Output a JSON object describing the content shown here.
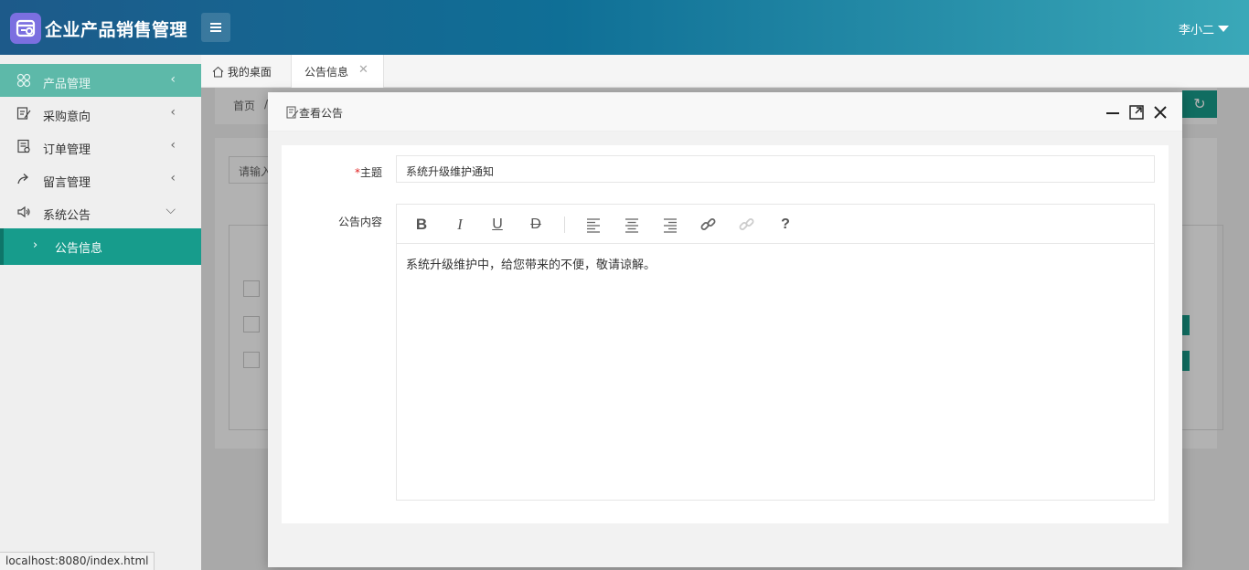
{
  "app": {
    "title": "企业产品销售管理",
    "user": "李小二"
  },
  "sidebar": {
    "items": [
      {
        "label": "产品管理",
        "icon": "grid-icon"
      },
      {
        "label": "采购意向",
        "icon": "edit-icon"
      },
      {
        "label": "订单管理",
        "icon": "order-icon"
      },
      {
        "label": "留言管理",
        "icon": "share-icon"
      },
      {
        "label": "系统公告",
        "icon": "speaker-icon"
      }
    ],
    "sub_item": {
      "label": "公告信息"
    }
  },
  "tabs": {
    "home": "我的桌面",
    "current": "公告信息"
  },
  "background": {
    "breadcrumb_home": "首页",
    "breadcrumb_sep": "/",
    "search_placeholder": "请输入"
  },
  "modal": {
    "title": "查看公告",
    "subject_label": "主题",
    "subject_value": "系统升级维护通知",
    "content_label": "公告内容",
    "content_text": "系统升级维护中，给您带来的不便，敬请谅解。",
    "toolbar": [
      "bold-icon",
      "italic-icon",
      "underline-icon",
      "strikethrough-icon",
      "align-left-icon",
      "align-center-icon",
      "align-right-icon",
      "link-icon",
      "unlink-icon",
      "help-icon"
    ]
  },
  "status_url": "localhost:8080/index.html",
  "colors": {
    "accent": "#179c8c",
    "header_start": "#1d5a8a",
    "header_end": "#3aa8b8",
    "logo": "#7b6fe0"
  }
}
